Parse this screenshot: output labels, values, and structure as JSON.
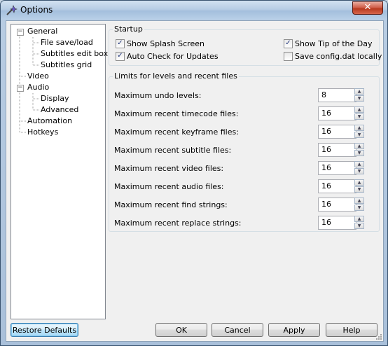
{
  "window": {
    "title": "Options",
    "close_label": "✕"
  },
  "tree": {
    "items": [
      {
        "label": "General",
        "level": 0,
        "expander": "−"
      },
      {
        "label": "File save/load",
        "level": 1
      },
      {
        "label": "Subtitles edit box",
        "level": 1
      },
      {
        "label": "Subtitles grid",
        "level": 1
      },
      {
        "label": "Video",
        "level": 0
      },
      {
        "label": "Audio",
        "level": 0,
        "expander": "−"
      },
      {
        "label": "Display",
        "level": 1
      },
      {
        "label": "Advanced",
        "level": 1
      },
      {
        "label": "Automation",
        "level": 0
      },
      {
        "label": "Hotkeys",
        "level": 0
      }
    ]
  },
  "startup": {
    "title": "Startup",
    "show_splash": {
      "label": "Show Splash Screen",
      "checked": true
    },
    "auto_check": {
      "label": "Auto Check for Updates",
      "checked": true
    },
    "show_tip": {
      "label": "Show Tip of the Day",
      "checked": true
    },
    "save_config": {
      "label": "Save config.dat locally",
      "checked": false
    }
  },
  "limits": {
    "title": "Limits for levels and recent files",
    "rows": [
      {
        "label": "Maximum undo levels:",
        "value": "8"
      },
      {
        "label": "Maximum recent timecode files:",
        "value": "16"
      },
      {
        "label": "Maximum recent keyframe files:",
        "value": "16"
      },
      {
        "label": "Maximum recent subtitle files:",
        "value": "16"
      },
      {
        "label": "Maximum recent video files:",
        "value": "16"
      },
      {
        "label": "Maximum recent audio files:",
        "value": "16"
      },
      {
        "label": "Maximum recent find strings:",
        "value": "16"
      },
      {
        "label": "Maximum recent replace strings:",
        "value": "16"
      }
    ]
  },
  "buttons": {
    "restore_defaults": "Restore Defaults",
    "ok": "OK",
    "cancel": "Cancel",
    "apply": "Apply",
    "help": "Help"
  },
  "colors": {
    "close_red": "#c8442a",
    "accent_blue": "#3c7fb1"
  }
}
